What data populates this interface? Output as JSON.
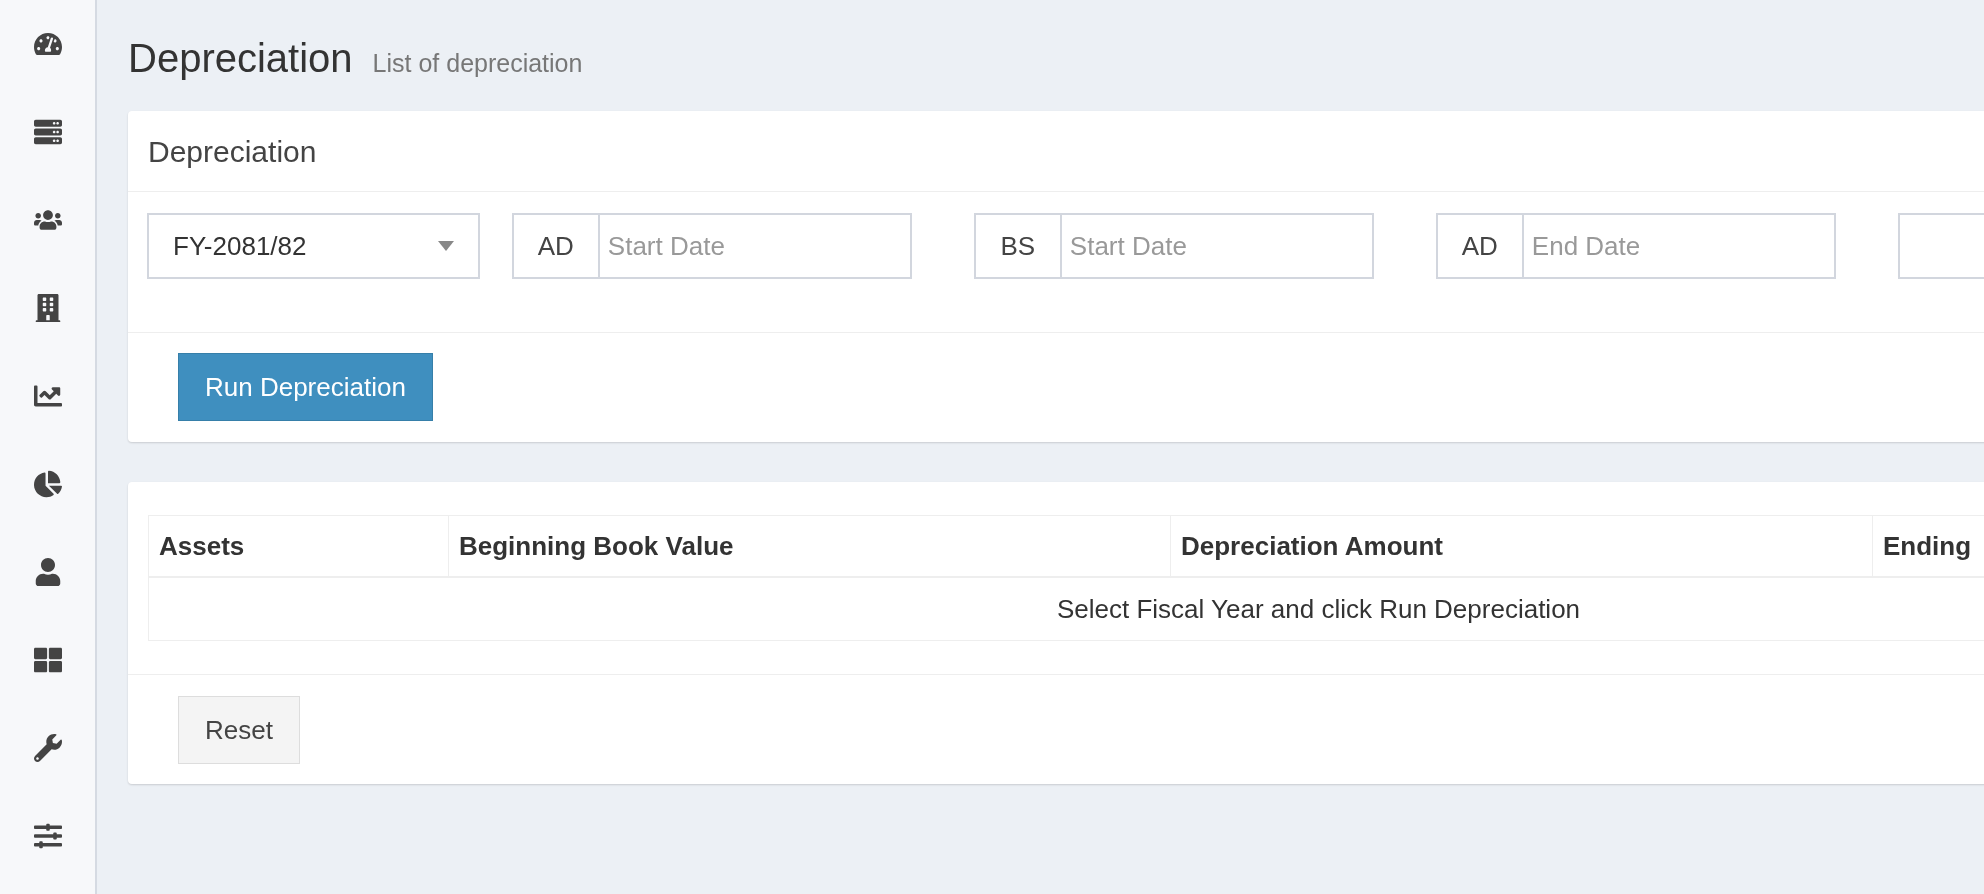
{
  "page": {
    "title": "Depreciation",
    "subtitle": "List of depreciation"
  },
  "filter_card": {
    "title": "Depreciation",
    "fiscal_year": {
      "value": "FY-2081/82"
    },
    "date_fields": [
      {
        "addon": "AD",
        "placeholder": "Start Date"
      },
      {
        "addon": "BS",
        "placeholder": "Start Date"
      },
      {
        "addon": "AD",
        "placeholder": "End Date"
      }
    ],
    "run_button": "Run Depreciation"
  },
  "table": {
    "columns": [
      "Assets",
      "Beginning Book Value",
      "Depreciation Amount",
      "Ending"
    ],
    "empty_message": "Select Fiscal Year and click Run Depreciation"
  },
  "reset_button": "Reset"
}
